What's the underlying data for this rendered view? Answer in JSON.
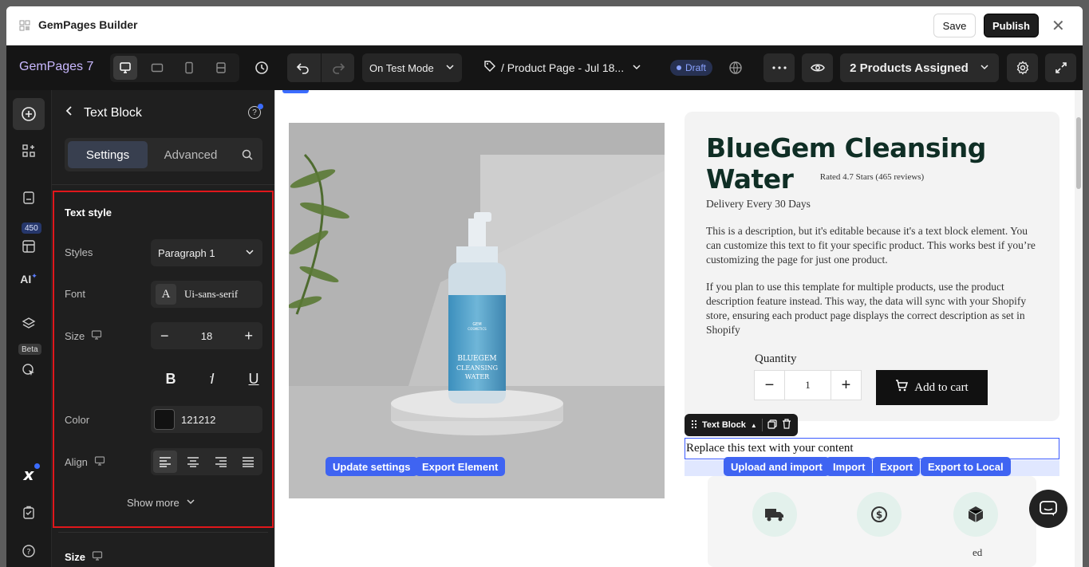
{
  "window": {
    "title": "GemPages Builder",
    "save_label": "Save",
    "publish_label": "Publish"
  },
  "toolbar": {
    "logo": "GemPages 7",
    "test_mode": "On Test Mode",
    "page_name": "/ Product Page - Jul 18...",
    "status": "Draft",
    "products_assigned": "2 Products Assigned"
  },
  "rail": {
    "badge_count": "450",
    "ai_label": "AI",
    "beta_label": "Beta"
  },
  "panel": {
    "title": "Text Block",
    "tabs": [
      "Settings",
      "Advanced"
    ],
    "section_title": "Text style",
    "styles_label": "Styles",
    "styles_value": "Paragraph 1",
    "font_label": "Font",
    "font_icon_letter": "A",
    "font_value": "Ui-sans-serif",
    "size_label": "Size",
    "size_value": "18",
    "color_label": "Color",
    "color_value": "121212",
    "align_label": "Align",
    "show_more": "Show more",
    "next_section": "Size"
  },
  "product": {
    "bottle_brand": "GEM",
    "bottle_brand_sub": "COSMETICS",
    "bottle_text": "BLUEGEM",
    "bottle_text2": "CLEANSING",
    "bottle_text3": "WATER",
    "title": "BlueGem Cleansing Water",
    "rating": "Rated 4.7 Stars (465 reviews)",
    "delivery": "Delivery Every 30 Days",
    "desc1": "This is a description, but it's editable because it's a text block element. You can customize this text to fit your specific product. This works best if you’re customizing the page for just one product.",
    "desc2": "If you plan to use this template for multiple products, use the product description feature instead. This way, the data will sync with your Shopify store, ensuring each product page displays the correct description as set in Shopify",
    "quantity_label": "Quantity",
    "quantity_value": "1",
    "add_to_cart": "Add to cart"
  },
  "text_block": {
    "chip_label": "Text Block",
    "content": "Replace this text with your content"
  },
  "features": {
    "partial_text": "ed"
  },
  "actions": [
    "Update settings",
    "Export Element",
    "Upload and import",
    "Import",
    "Export",
    "Export to Local"
  ],
  "colors": {
    "accent": "#3b6cff",
    "danger_outline": "#e0171b",
    "title_green": "#0f2e25",
    "bottle_blue": "#5aa7cf"
  }
}
